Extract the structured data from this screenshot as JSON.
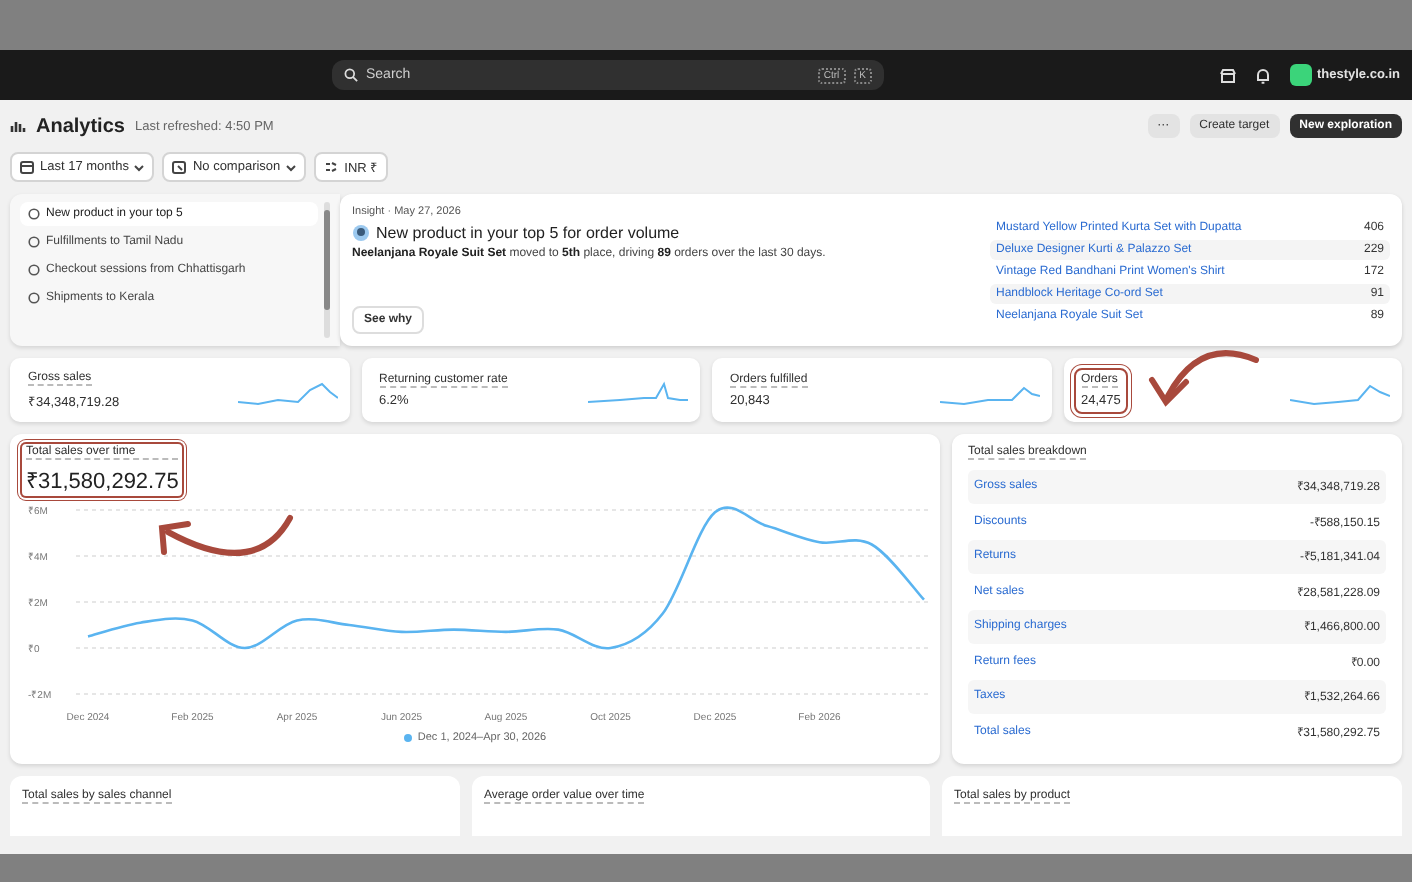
{
  "topbar": {
    "search": {
      "placeholder": "Search",
      "shortcut": [
        "Ctrl",
        "K"
      ]
    },
    "store": "thestyle.co.in"
  },
  "header": {
    "title": "Analytics",
    "refreshed": "Last refreshed: 4:50 PM",
    "more": "···",
    "buttons": [
      {
        "label": "Create target",
        "kind": "secondary"
      },
      {
        "label": "New exploration",
        "kind": "primary"
      }
    ]
  },
  "filters": [
    {
      "label": "Last 17 months",
      "kind": "dropdown"
    },
    {
      "label": "No comparison",
      "kind": "dropdown"
    },
    {
      "label": "INR ₹",
      "kind": "plain"
    }
  ],
  "insights": {
    "items": [
      {
        "label": "New product in your top 5",
        "selected": true
      },
      {
        "label": "Fulfillments to Tamil Nadu",
        "selected": false
      },
      {
        "label": "Checkout sessions from Chhattisgarh",
        "selected": false
      },
      {
        "label": "Shipments to Kerala",
        "selected": false
      }
    ],
    "meta": "Insight · May 27, 2026",
    "headline": "New product in your top 5 for order volume",
    "body": "**Neelanjana Royale Suit Set** moved to **5th** place, driving **89** orders over the last 30 days.",
    "action": "See why",
    "products": [
      {
        "name": "Mustard Yellow Printed Kurta Set with Dupatta",
        "count": "406"
      },
      {
        "name": "Deluxe Designer Kurti & Palazzo Set",
        "count": "229"
      },
      {
        "name": "Vintage Red Bandhani Print Women's Shirt",
        "count": "172"
      },
      {
        "name": "Handblock Heritage Co-ord Set",
        "count": "91"
      },
      {
        "name": "Neelanjana Royale Suit Set",
        "count": "89"
      }
    ]
  },
  "kpis": [
    {
      "label": "Gross sales",
      "value": "₹34,348,719.28",
      "highlighted": false
    },
    {
      "label": "Returning customer rate",
      "value": "6.2%",
      "highlighted": false
    },
    {
      "label": "Orders fulfilled",
      "value": "20,843",
      "highlighted": false
    },
    {
      "label": "Orders",
      "value": "24,475",
      "highlighted": true
    }
  ],
  "sales_chart": {
    "title": "Total sales over time",
    "total": "₹31,580,292.75",
    "highlighted": true,
    "chart_data": {
      "type": "line",
      "grid": true,
      "categories": [
        "Dec 2024",
        null,
        "Feb 2025",
        null,
        "Apr 2025",
        null,
        "Jun 2025",
        null,
        "Aug 2025",
        null,
        "Oct 2025",
        null,
        "Dec 2025",
        null,
        "Feb 2026",
        null,
        null
      ],
      "yticks": [
        {
          "value": 6000000,
          "label": "₹6M"
        },
        {
          "value": 4000000,
          "label": "₹4M"
        },
        {
          "value": 2000000,
          "label": "₹2M"
        },
        {
          "value": 0,
          "label": "₹0"
        },
        {
          "value": -2000000,
          "label": "-₹2M"
        }
      ],
      "ylim": [
        -2000000,
        6000000
      ],
      "series": [
        {
          "name": "Dec 1, 2024–Apr 30, 2026",
          "color": "#5ab4f0",
          "values": [
            500000,
            1100000,
            1200000,
            0,
            1200000,
            1000000,
            700000,
            800000,
            700000,
            800000,
            0,
            1500000,
            5900000,
            5300000,
            4600000,
            4500000,
            2100000
          ]
        }
      ]
    }
  },
  "breakdown": {
    "title": "Total sales breakdown",
    "rows": [
      {
        "label": "Gross sales",
        "value": "₹34,348,719.28"
      },
      {
        "label": "Discounts",
        "value": "-₹588,150.15"
      },
      {
        "label": "Returns",
        "value": "-₹5,181,341.04"
      },
      {
        "label": "Net sales",
        "value": "₹28,581,228.09"
      },
      {
        "label": "Shipping charges",
        "value": "₹1,466,800.00"
      },
      {
        "label": "Return fees",
        "value": "₹0.00"
      },
      {
        "label": "Taxes",
        "value": "₹1,532,264.66"
      },
      {
        "label": "Total sales",
        "value": "₹31,580,292.75"
      }
    ]
  },
  "bottom_cards": [
    "Total sales by sales channel",
    "Average order value over time",
    "Total sales by product"
  ]
}
